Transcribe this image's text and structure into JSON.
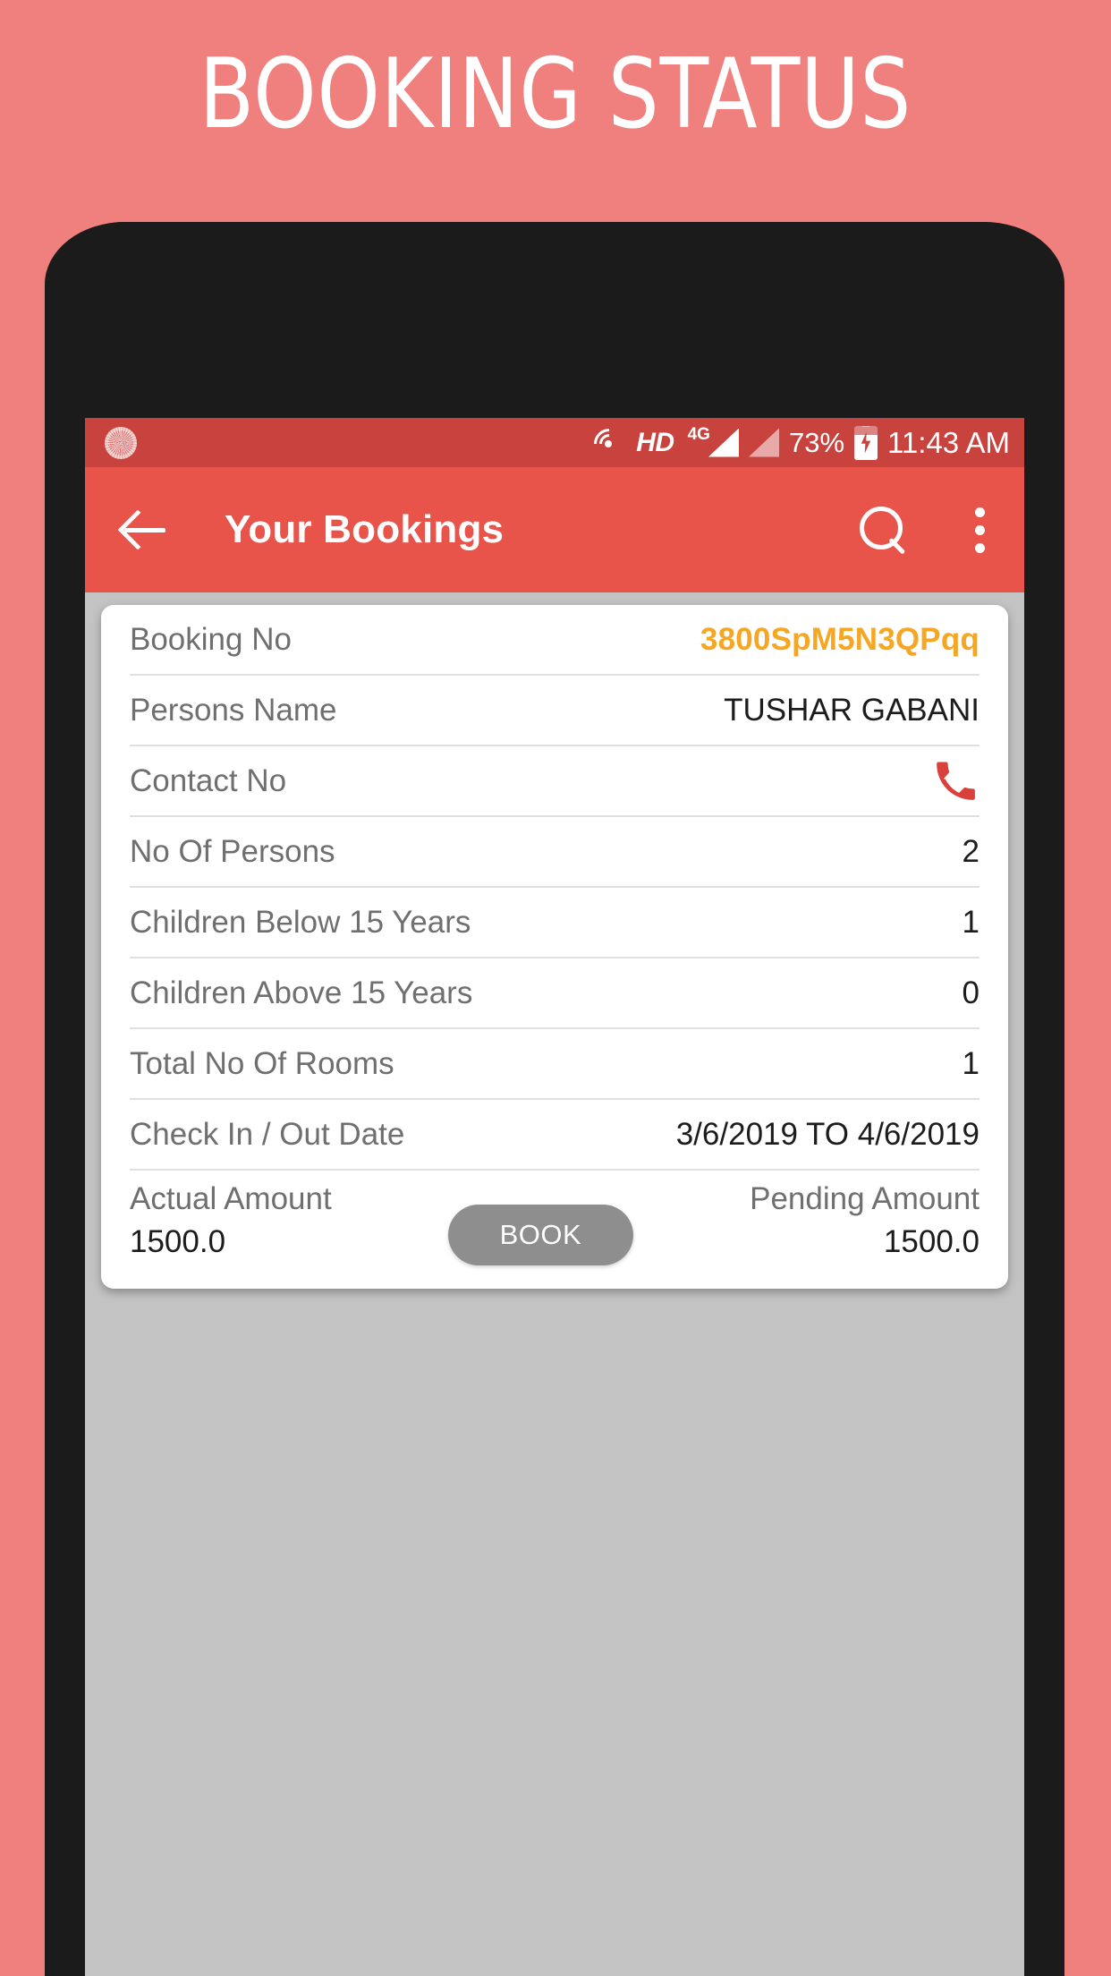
{
  "poster": {
    "title": "BOOKING STATUS",
    "background_color": "#F0807E"
  },
  "device": {
    "bezel_color": "#1b1b1b",
    "screen_background": "#c3c3c3"
  },
  "status_bar": {
    "background_color": "#C9433E",
    "left_icon": "sunburst-icon",
    "icons": [
      "volte-hd-icon",
      "hd-label",
      "4g-label",
      "signal-bars-icon",
      "signal-bars-icon"
    ],
    "hd_label": "HD",
    "network_label": "4G",
    "battery_percent": "73%",
    "battery_charging": true,
    "time": "11:43 AM"
  },
  "app_bar": {
    "background_color": "#E8534A",
    "title": "Your Bookings",
    "back_icon": "arrow-left-icon",
    "search_icon": "search-icon",
    "overflow_icon": "more-vertical-icon"
  },
  "card": {
    "accent_color": "#F5A623",
    "rows": [
      {
        "label": "Booking No",
        "value": "3800SpM5N3QPqq",
        "accent": true
      },
      {
        "label": "Persons Name",
        "value": "TUSHAR GABANI"
      },
      {
        "label": "Contact No",
        "value": "",
        "icon": "phone-call-icon"
      },
      {
        "label": "No Of Persons",
        "value": "2"
      },
      {
        "label": "Children Below 15 Years",
        "value": "1"
      },
      {
        "label": "Children Above 15 Years",
        "value": "0"
      },
      {
        "label": "Total No Of Rooms",
        "value": "1"
      },
      {
        "label": "Check In / Out Date",
        "value": "3/6/2019 TO 4/6/2019"
      }
    ],
    "footer": {
      "actual_label": "Actual Amount",
      "actual_value": "1500.0",
      "book_button": "BOOK",
      "book_button_color": "#8e8e8e",
      "pending_label": "Pending Amount",
      "pending_value": "1500.0"
    }
  }
}
